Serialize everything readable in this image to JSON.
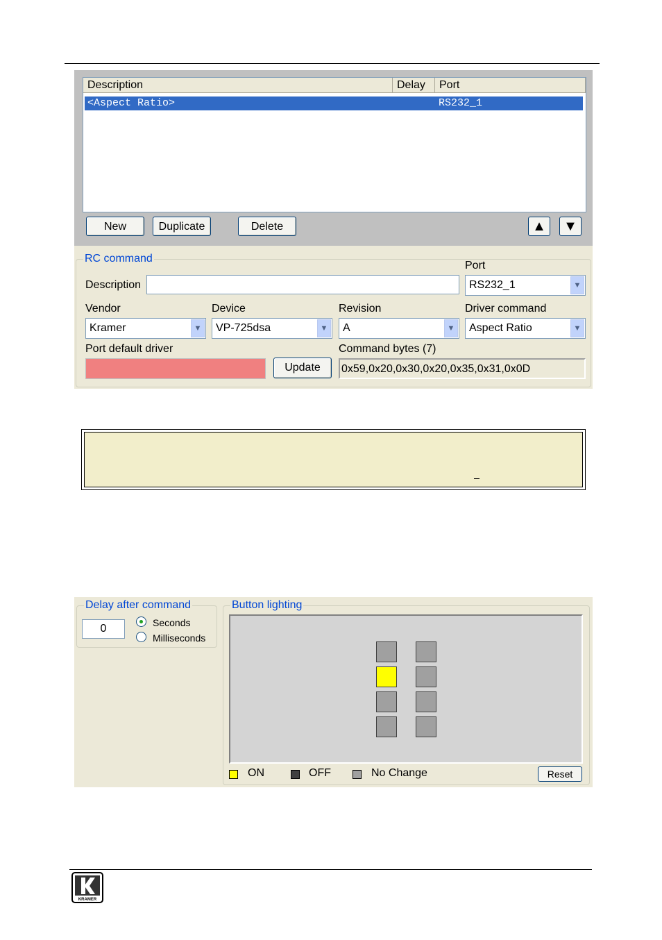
{
  "command_list": {
    "columns": [
      "Description",
      "Delay",
      "Port"
    ],
    "rows": [
      {
        "description": "<Aspect Ratio>",
        "delay": "",
        "port": "RS232_1",
        "selected": true
      }
    ],
    "buttons": {
      "new": "New",
      "duplicate": "Duplicate",
      "delete": "Delete"
    },
    "move_up_icon": "up-triangle-icon",
    "move_down_icon": "down-triangle-icon"
  },
  "rc_command": {
    "legend": "RC command",
    "description_label": "Description",
    "description_value": "",
    "port_label": "Port",
    "port_value": "RS232_1",
    "vendor_label": "Vendor",
    "vendor_value": "Kramer",
    "device_label": "Device",
    "device_value": "VP-725dsa",
    "revision_label": "Revision",
    "revision_value": "A",
    "driver_command_label": "Driver command",
    "driver_command_value": "Aspect Ratio",
    "port_default_driver_label": "Port default driver",
    "port_default_driver_color": "#f08080",
    "update_button": "Update",
    "command_bytes_label": "Command bytes (7)",
    "command_bytes_value": "0x59,0x20,0x30,0x20,0x35,0x31,0x0D"
  },
  "delay_after_command": {
    "legend": "Delay after command",
    "value": "0",
    "options": [
      "Seconds",
      "Milliseconds"
    ],
    "selected": "Seconds"
  },
  "button_lighting": {
    "legend": "Button lighting",
    "grid": [
      [
        "nochange",
        "nochange"
      ],
      [
        "on",
        "nochange"
      ],
      [
        "nochange",
        "nochange"
      ],
      [
        "nochange",
        "nochange"
      ]
    ],
    "legend_items": [
      {
        "label": "ON",
        "color": "#ffff00"
      },
      {
        "label": "OFF",
        "color": "#404040"
      },
      {
        "label": "No Change",
        "color": "#a0a0a0"
      }
    ],
    "reset_button": "Reset"
  },
  "colors": {
    "on": "#ffff00",
    "off": "#404040",
    "nochange": "#a0a0a0",
    "selection": "#316ac5",
    "legend_text": "#0046d5",
    "note_background": "#f2eecb"
  },
  "footer_logo": {
    "letter": "K",
    "text": "KRAMER"
  }
}
